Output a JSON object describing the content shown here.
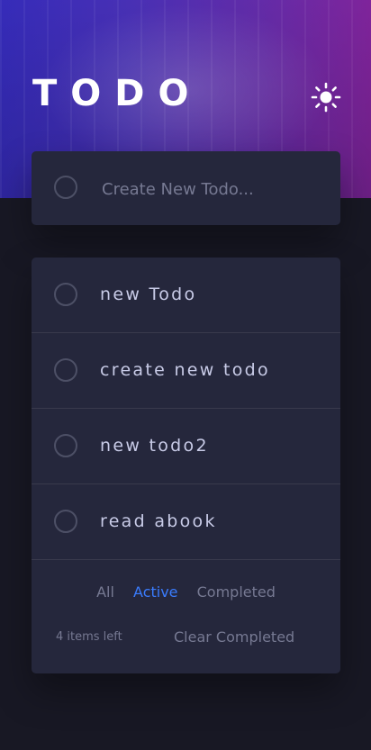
{
  "header": {
    "title": "TODO",
    "theme_icon": "sun-icon"
  },
  "new_todo": {
    "placeholder": "Create New Todo..."
  },
  "todos": [
    {
      "text": "new Todo",
      "completed": false
    },
    {
      "text": "create new todo",
      "completed": false
    },
    {
      "text": "new todo2",
      "completed": false
    },
    {
      "text": "read abook",
      "completed": false
    }
  ],
  "filters": {
    "all": "All",
    "active": "Active",
    "completed": "Completed",
    "selected": "Active"
  },
  "footer": {
    "items_left": "4 items left",
    "clear_completed": "Clear Completed"
  },
  "colors": {
    "accent": "#3a7cfd",
    "background": "#181824",
    "card": "#25273c",
    "text": "#c8cbe7",
    "muted": "#767992",
    "gradient_start": "#3a2fc9",
    "gradient_end": "#8a27a8"
  }
}
